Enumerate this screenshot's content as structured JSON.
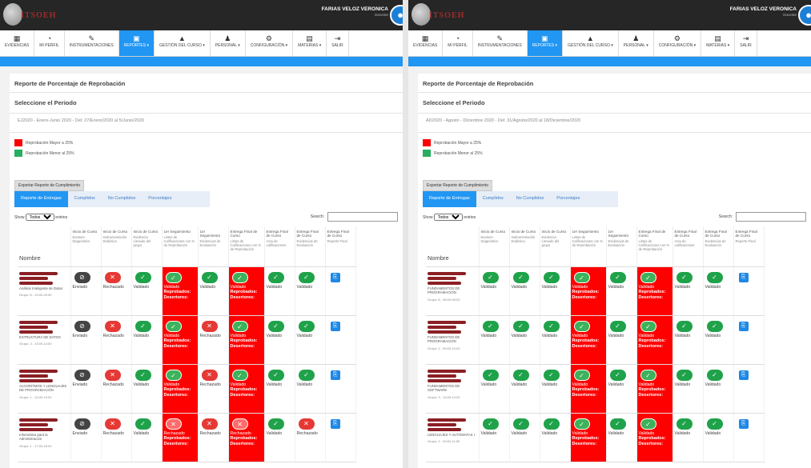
{
  "topbar": {
    "logo_text": "ITSOEH",
    "user_name": "FARIAS VELOZ VERONICA",
    "user_sub": "Docente"
  },
  "nav": [
    {
      "label": "EVIDENCIAS",
      "icon": "▦",
      "icon_name": "grid-icon"
    },
    {
      "label": "MI PERFIL",
      "icon": "◔",
      "icon_name": "dashboard-icon"
    },
    {
      "label": "INSTRUMENTACIONES",
      "icon": "✎",
      "icon_name": "pencil-icon"
    },
    {
      "label": "REPORTES ▾",
      "icon": "▣",
      "icon_name": "reports-icon",
      "active": true
    },
    {
      "label": "GESTIÓN DEL CURSO ▾",
      "icon": "▲",
      "icon_name": "course-icon"
    },
    {
      "label": "PERSONAL ▾",
      "icon": "♟",
      "icon_name": "person-icon"
    },
    {
      "label": "CONFIGURACIÓN ▾",
      "icon": "⚙",
      "icon_name": "gear-icon"
    },
    {
      "label": "MATERIAS ▾",
      "icon": "▤",
      "icon_name": "book-icon"
    },
    {
      "label": "SALIR",
      "icon": "⇥",
      "icon_name": "logout-icon"
    }
  ],
  "report_title": "Reporte de Porcentaje de Reprobación",
  "select_period_label": "Seleccione el Periodo",
  "legend": {
    "high": "Reprobación Mayor a 25%",
    "low": "Reprobación Menor al 25%",
    "high_color": "#ff0000",
    "low_color": "#27ae60"
  },
  "export_label": "Exportar Reporte de Cumplimiento",
  "tabs": [
    "Reporte de Entregas",
    "Cumplidos",
    "No Cumplidos",
    "Porcentajes"
  ],
  "show_label": "Show",
  "entries_label": "entries",
  "show_value": "Todos",
  "search_label": "Search:",
  "columns": [
    {
      "title": "Nombre"
    },
    {
      "title": "Inicio de Curso",
      "sub": "Examen Diagnóstico"
    },
    {
      "title": "Inicio de Curso",
      "sub": "Instrumentación Didáctica"
    },
    {
      "title": "Inicio de Curso",
      "sub": "Evidencia Llenado del grupo"
    },
    {
      "title": "1er Seguimiento",
      "sub": "Listas de Calificaciones con % de Reprobación"
    },
    {
      "title": "1er Seguimiento",
      "sub": "Evidencias de Evaluación"
    },
    {
      "title": "Entrega Final de Curso",
      "sub": "Listas de Calificaciones con % de Reprobación"
    },
    {
      "title": "Entrega Final de Curso",
      "sub": "Acta de calificaciones"
    },
    {
      "title": "Entrega Final de Curso",
      "sub": "Evidencias de Evaluación"
    },
    {
      "title": "Entrega Final de Curso",
      "sub": "Reporte Final"
    }
  ],
  "labels": {
    "validado": "Validado",
    "rechazado": "Rechazado",
    "enviado": "Enviado",
    "reprobados": "Reprobados:",
    "desertores": "Desertores:"
  },
  "panel1": {
    "period": "EJ2020 - Enero-Junio 2020 - Del: 27/Enero/2020 al 5/Junio/2020",
    "rows": [
      {
        "subject": "Análisis Inteligente de Datos",
        "group": "Grupo: 8 - 19:00-20:00",
        "cells": [
          "enviado",
          "rechazado",
          "validado",
          "red-validado",
          "validado",
          "red-validado",
          "validado",
          "validado",
          "doc"
        ]
      },
      {
        "subject": "ESTRUCTURA DE DATOS",
        "group": "Grupo: 3 - 13:00-14:00",
        "cells": [
          "enviado",
          "rechazado",
          "validado",
          "red-validado",
          "rechazado",
          "red-validado",
          "validado",
          "validado",
          "doc"
        ]
      },
      {
        "subject": "ALGORITMOS Y LENGUAJES DE PROGRAMACIÓN",
        "group": "Grupo: 1 - 12:00-13:00",
        "cells": [
          "enviado",
          "rechazado",
          "validado",
          "red-validado",
          "rechazado",
          "red-validado",
          "validado",
          "validado",
          "doc"
        ]
      },
      {
        "subject": "Informática para la Administración",
        "group": "Grupo: 1 - 17:00-18:00",
        "cells": [
          "enviado",
          "rechazado",
          "validado",
          "red-rechazado",
          "rechazado",
          "red-rechazado",
          "validado",
          "rechazado",
          "doc"
        ]
      }
    ]
  },
  "panel2": {
    "period": "AD2020 - Agosto - Diciembre 2020 - Del: 31/Agosto/2020 al 18/Diciembre/2020",
    "rows": [
      {
        "subject": "FUNDAMENTOS DE PROGRAMACIÓN",
        "group": "Grupo: 8 - 08:00-09:00",
        "cells": [
          "validado",
          "validado",
          "validado",
          "red-validado",
          "validado",
          "red-validado",
          "validado",
          "validado",
          "doc"
        ]
      },
      {
        "subject": "FUNDAMENTOS DE PROGRAMACIÓN",
        "group": "Grupo: 2 - 09:00-10:00",
        "cells": [
          "validado",
          "validado",
          "validado",
          "red-validado",
          "validado",
          "red-validado",
          "validado",
          "validado",
          "doc"
        ]
      },
      {
        "subject": "FUNDAMENTOS DE SOFTWARE",
        "group": "Grupo: 3 - 13:00-14:00",
        "cells": [
          "validado",
          "validado",
          "validado",
          "red-validado",
          "validado",
          "red-validado",
          "validado",
          "validado",
          "doc"
        ]
      },
      {
        "subject": "LENGUAJES Y AUTÓMATAS I",
        "group": "Grupo: 2 - 09:00-11:00",
        "cells": [
          "validado",
          "validado",
          "validado",
          "red-validado",
          "validado",
          "red-validado",
          "validado",
          "validado",
          "doc"
        ]
      }
    ]
  }
}
